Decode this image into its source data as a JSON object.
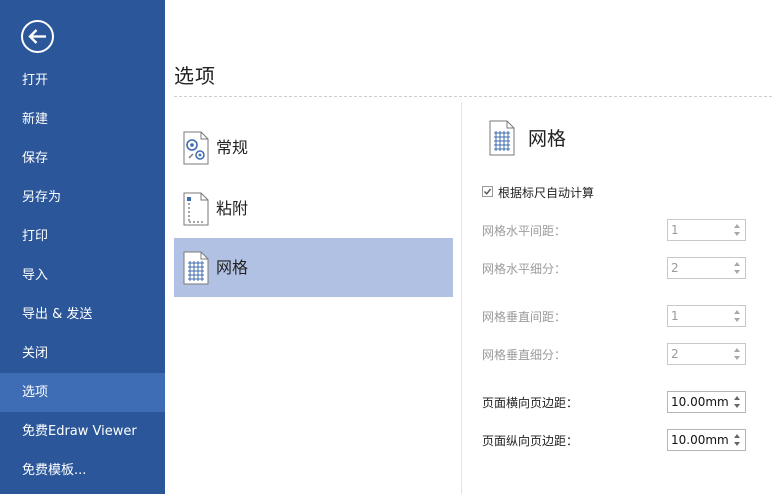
{
  "colors": {
    "sidebar": "#2b579a",
    "sidebar_active": "#3e6db5",
    "category_active": "#b1c1e3"
  },
  "sidebar": {
    "back_icon": "back-arrow-circle-icon",
    "items": [
      {
        "label": "打开"
      },
      {
        "label": "新建"
      },
      {
        "label": "保存"
      },
      {
        "label": "另存为"
      },
      {
        "label": "打印"
      },
      {
        "label": "导入"
      },
      {
        "label": "导出 & 发送"
      },
      {
        "label": "关闭"
      },
      {
        "label": "选项",
        "active": true
      },
      {
        "label": "免费Edraw Viewer"
      },
      {
        "label": "免费模板..."
      }
    ]
  },
  "main": {
    "title": "选项",
    "categories": [
      {
        "label": "常规",
        "icon": "general-settings-icon"
      },
      {
        "label": "粘附",
        "icon": "snap-icon"
      },
      {
        "label": "网格",
        "icon": "grid-icon",
        "active": true
      }
    ]
  },
  "panel": {
    "title": "网格",
    "icon": "grid-icon",
    "auto_calc": {
      "label": "根据标尺自动计算",
      "checked": true
    },
    "fields": [
      {
        "label": "网格水平间距：",
        "value": "1",
        "enabled": false
      },
      {
        "label": "网格水平细分：",
        "value": "2",
        "enabled": false
      },
      {
        "label": "网格垂直间距：",
        "value": "1",
        "enabled": false
      },
      {
        "label": "网格垂直细分：",
        "value": "2",
        "enabled": false
      },
      {
        "label": "页面横向页边距：",
        "value": "10.00mm",
        "enabled": true
      },
      {
        "label": "页面纵向页边距：",
        "value": "10.00mm",
        "enabled": true
      }
    ]
  }
}
